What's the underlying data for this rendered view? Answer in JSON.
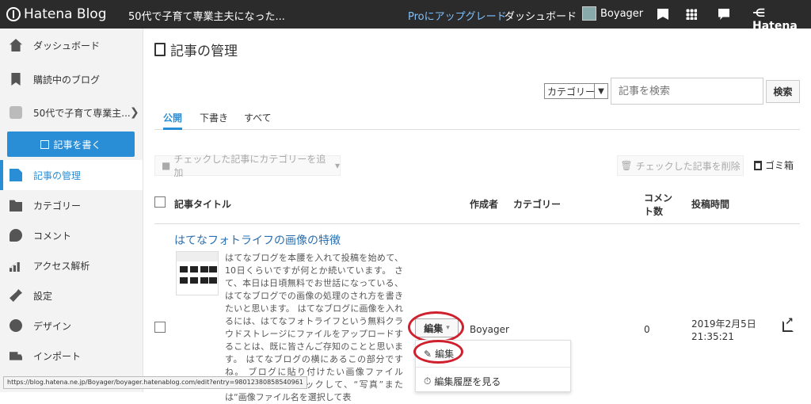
{
  "topbar": {
    "logo_text": "Hatena Blog",
    "blog_title": "50代で子育て専業主夫になった...",
    "pro_link": "Proにアップグレード",
    "dashboard_link": "ダッシュボード",
    "username": "Boyager",
    "brand": "Hatena"
  },
  "sidebar": {
    "items": [
      {
        "label": "ダッシュボード",
        "icon": "home-icon"
      },
      {
        "label": "購読中のブログ",
        "icon": "bookmark-icon"
      },
      {
        "label": "50代で子育て専業主...",
        "icon": "blog-icon"
      },
      {
        "label": "記事の管理",
        "icon": "document-icon"
      },
      {
        "label": "カテゴリー",
        "icon": "folder-icon"
      },
      {
        "label": "コメント",
        "icon": "comment-icon"
      },
      {
        "label": "アクセス解析",
        "icon": "bar-chart-icon"
      },
      {
        "label": "設定",
        "icon": "wrench-icon"
      },
      {
        "label": "デザイン",
        "icon": "palette-icon"
      },
      {
        "label": "インポート",
        "icon": "truck-icon"
      }
    ],
    "write_button": "記事を書く",
    "accent": "#2a8ed6"
  },
  "main": {
    "title": "記事の管理",
    "category_select": "カテゴリー",
    "search_placeholder": "記事を検索",
    "search_button": "検索",
    "tabs": [
      {
        "label": "公開",
        "active": true
      },
      {
        "label": "下書き",
        "active": false
      },
      {
        "label": "すべて",
        "active": false
      }
    ],
    "add_category_button": "チェックした記事にカテゴリーを追加",
    "delete_button": "チェックした記事を削除",
    "trash_link": "ゴミ箱",
    "table": {
      "headers": {
        "title": "記事タイトル",
        "author": "作成者",
        "category": "カテゴリー",
        "comments_line1": "コメン",
        "comments_line2": "ト数",
        "posted": "投稿時間"
      },
      "rows": [
        {
          "title": "はてなフォトライフの画像の特徴",
          "excerpt": "はてなブログを本腰を入れて投稿を始めて、10日くらいですが何とか続いています。 さて、本日は日頃無料でお世話になっている、はてなブログでの画像の処理のされ方を書きたいと思います。 はてなブログに画像を入れるには、はてなフォトライフという無料クラウドストレージにファイルをアップロードすることは、既に皆さんご存知のことと思います。 はてなブログの横にあるこの部分ですね。 ブログに貼り付けたい画像ファイルは、“参照”をクリックして、“写真”または“画像ファイル名を選択して表",
          "edit_button": "編集",
          "author": "Boyager",
          "comments": "0",
          "date": "2019年2月5日",
          "time": "21:35:21"
        }
      ]
    },
    "edit_menu": {
      "edit": "編集",
      "history": "編集履歴を見る"
    }
  },
  "status_url": "https://blog.hatena.ne.jp/Boyager/boyager.hatenablog.com/edit?entry=98012380858540961",
  "highlight_color": "#d01f2d"
}
